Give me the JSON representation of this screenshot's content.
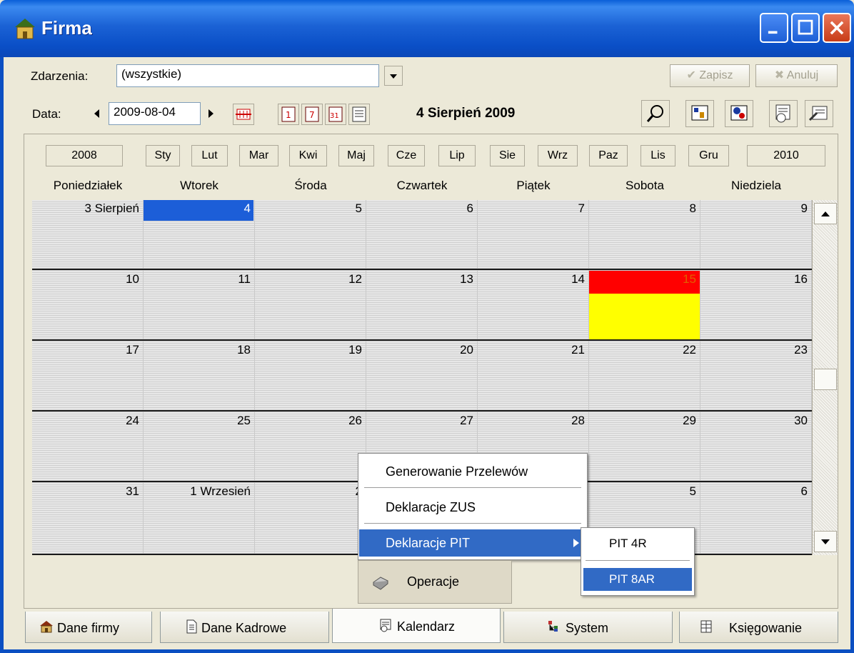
{
  "window": {
    "title": "Firma"
  },
  "filter": {
    "label": "Zdarzenia:",
    "value": "(wszystkie)"
  },
  "date": {
    "label": "Data:",
    "value": "2009-08-04",
    "display": "4 Sierpień 2009"
  },
  "actions": {
    "save": "Zapisz",
    "cancel": "Anuluj"
  },
  "nav": {
    "prev_year": "2008",
    "months": [
      "Sty",
      "Lut",
      "Mar",
      "Kwi",
      "Maj",
      "Cze",
      "Lip",
      "Sie",
      "Wrz",
      "Paz",
      "Lis",
      "Gru"
    ],
    "next_year": "2010"
  },
  "weekdays": [
    "Poniedziałek",
    "Wtorek",
    "Środa",
    "Czwartek",
    "Piątek",
    "Sobota",
    "Niedziela"
  ],
  "weeks": [
    [
      "3 Sierpień",
      "4",
      "5",
      "6",
      "7",
      "8",
      "9"
    ],
    [
      "10",
      "11",
      "12",
      "13",
      "14",
      "15",
      "16"
    ],
    [
      "17",
      "18",
      "19",
      "20",
      "21",
      "22",
      "23"
    ],
    [
      "24",
      "25",
      "26",
      "27",
      "28",
      "29",
      "30"
    ],
    [
      "31",
      "1 Wrzesień",
      "2",
      "",
      "",
      "5",
      "6"
    ]
  ],
  "colors": {
    "selected": "#1c5ed8",
    "event_red": "#ff0000",
    "event_yellow": "#ffff00",
    "menu_highlight": "#316ac5"
  },
  "menu": {
    "items": [
      "Generowanie Przelewów",
      "Deklaracje ZUS",
      "Deklaracje PIT"
    ],
    "highlighted": "Deklaracje PIT",
    "submenu": [
      "PIT 4R",
      "PIT 8AR"
    ],
    "submenu_highlighted": "PIT 8AR",
    "button": "Operacje"
  },
  "tabs": [
    {
      "label": "Dane firmy",
      "icon": "house-icon"
    },
    {
      "label": "Dane Kadrowe",
      "icon": "document-icon"
    },
    {
      "label": "Kalendarz",
      "icon": "calendar-icon"
    },
    {
      "label": "System",
      "icon": "tree-icon"
    },
    {
      "label": "Księgowanie",
      "icon": "ledger-icon"
    }
  ],
  "active_tab": "Kalendarz"
}
